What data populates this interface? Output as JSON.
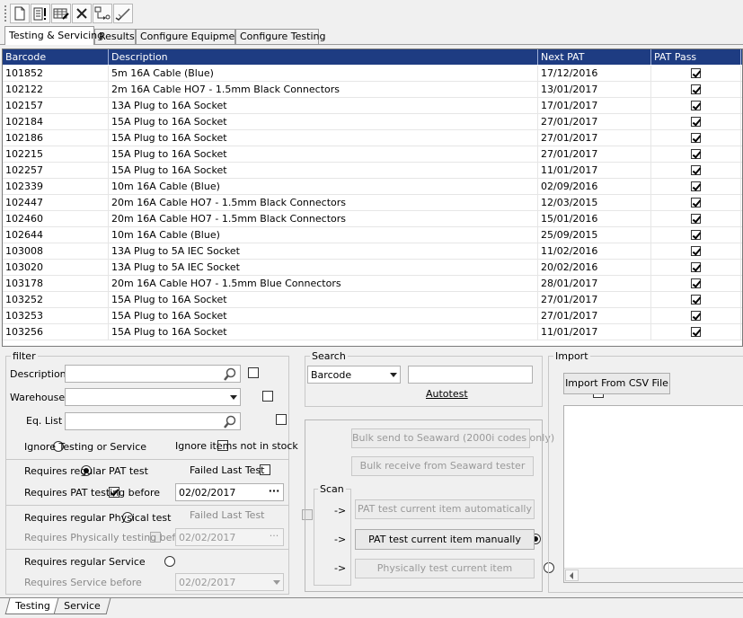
{
  "toolbar": {
    "icons": [
      "new-document-icon",
      "document-alert-icon",
      "edit-grid-icon",
      "delete-x-icon",
      "scan-arrow-icon",
      "approve-check-icon"
    ]
  },
  "tabs": [
    {
      "label": "Testing & Servicing",
      "active": true
    },
    {
      "label": "Results"
    },
    {
      "label": "Configure Equipment"
    },
    {
      "label": "Configure Testing"
    }
  ],
  "grid": {
    "columns": [
      "Barcode",
      "Description",
      "Next PAT",
      "PAT Pass"
    ],
    "rows": [
      [
        "101852",
        "5m 16A Cable (Blue)",
        "17/12/2016",
        true
      ],
      [
        "102122",
        "2m 16A Cable HO7 - 1.5mm Black Connectors",
        "13/01/2017",
        true
      ],
      [
        "102157",
        "13A Plug to 16A Socket",
        "17/01/2017",
        true
      ],
      [
        "102184",
        "15A Plug to 16A Socket",
        "27/01/2017",
        true
      ],
      [
        "102186",
        "15A Plug to 16A Socket",
        "27/01/2017",
        true
      ],
      [
        "102215",
        "15A Plug to 16A Socket",
        "27/01/2017",
        true
      ],
      [
        "102257",
        "15A Plug to 16A Socket",
        "11/01/2017",
        true
      ],
      [
        "102339",
        "10m 16A Cable (Blue)",
        "02/09/2016",
        true
      ],
      [
        "102447",
        "20m 16A Cable HO7 - 1.5mm Black Connectors",
        "12/03/2015",
        true
      ],
      [
        "102460",
        "20m 16A Cable HO7 - 1.5mm Black Connectors",
        "15/01/2016",
        true
      ],
      [
        "102644",
        "10m 16A Cable (Blue)",
        "25/09/2015",
        true
      ],
      [
        "103008",
        "13A Plug to 5A IEC Socket",
        "11/02/2016",
        true
      ],
      [
        "103020",
        "13A Plug to 5A IEC Socket",
        "20/02/2016",
        true
      ],
      [
        "103178",
        "20m 16A Cable  HO7 - 1.5mm Blue Connectors",
        "28/01/2017",
        true
      ],
      [
        "103252",
        "15A Plug to 16A Socket",
        "27/01/2017",
        true
      ],
      [
        "103253",
        "15A Plug to 16A Socket",
        "27/01/2017",
        true
      ],
      [
        "103256",
        "15A Plug to 16A Socket",
        "11/01/2017",
        true
      ]
    ]
  },
  "filter": {
    "title": "filter",
    "description_label": "Description",
    "warehouse_label": "Warehouse",
    "eqlist_label": "Eq. List",
    "ignore_testing": "Ignore Testing or Service",
    "ignore_stock": "Ignore items not in stock",
    "requires_pat": "Requires regular PAT test",
    "failed_last_test_1": "Failed Last Test",
    "requires_pat_before": "Requires PAT testing before",
    "pat_before_date": "02/02/2017",
    "requires_physical": "Requires regular Physical test",
    "failed_last_test_2": "Failed Last Test",
    "requires_physical_before": "Requires Physically testing before",
    "physical_before_date": "02/02/2017",
    "requires_service": "Requires regular Service",
    "requires_service_before": "Requires Service before",
    "service_before_date": "02/02/2017",
    "ellipsis": "···"
  },
  "search": {
    "title": "Search",
    "field": "Barcode",
    "value": "",
    "autotest": "Autotest"
  },
  "actions": {
    "bulk_send": "Bulk send to Seaward (2000i codes only)",
    "bulk_receive": "Bulk receive from Seaward tester",
    "scan_title": "Scan",
    "arrow": "->",
    "pat_auto": "PAT test current item automatically",
    "pat_manual": "PAT test current item manually",
    "physical": "Physically test current item"
  },
  "import": {
    "title": "Import",
    "button": "Import From CSV File"
  },
  "bottom_tabs": [
    "Testing",
    "Service"
  ]
}
